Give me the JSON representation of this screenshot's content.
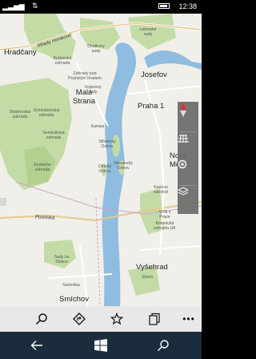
{
  "status": {
    "time": "12:38"
  },
  "map": {
    "labels_big": [
      "Hradčany",
      "Malá Strana",
      "Josefov",
      "Praha 1",
      "Nové Město",
      "Smíchov",
      "Vyšehrad"
    ],
    "labels_small": [
      "Letenské sady",
      "Chotkovy sady",
      "Královská zahrada",
      "Zahrady pod Pražským hradem",
      "Vojanovy sady",
      "Strahovská zahrada",
      "Schönbornská zahrada",
      "Seminářská zahrada",
      "Kinského zahrada",
      "Kampa",
      "Střelecký Ostrov",
      "Dětský Ostrov",
      "Slovanský Ostrov",
      "Karlovo náměstí",
      "VFN v Praze",
      "Botanická zahrada UK",
      "Sady na Skalce",
      "Santoška",
      "Slavín"
    ],
    "road_labels": [
      "Milady Horákové",
      "Plzeňská"
    ]
  },
  "controls": [
    {
      "name": "compass-icon",
      "icon": "compass"
    },
    {
      "name": "grid-icon",
      "icon": "grid"
    },
    {
      "name": "location-icon",
      "icon": "location"
    },
    {
      "name": "layers-icon",
      "icon": "layers"
    }
  ],
  "app_bar": [
    "search-icon",
    "directions-icon",
    "favorites-icon",
    "collections-icon",
    "more-icon"
  ],
  "nav_bar": [
    "back-icon",
    "windows-icon",
    "search-icon"
  ],
  "colors": {
    "water": "#8fbcdf",
    "park": "#c3dca6",
    "land": "#f1efe9",
    "appbar": "#e8e8e8",
    "navbar": "#1b2c3c",
    "controls": "#6b6b6b"
  }
}
